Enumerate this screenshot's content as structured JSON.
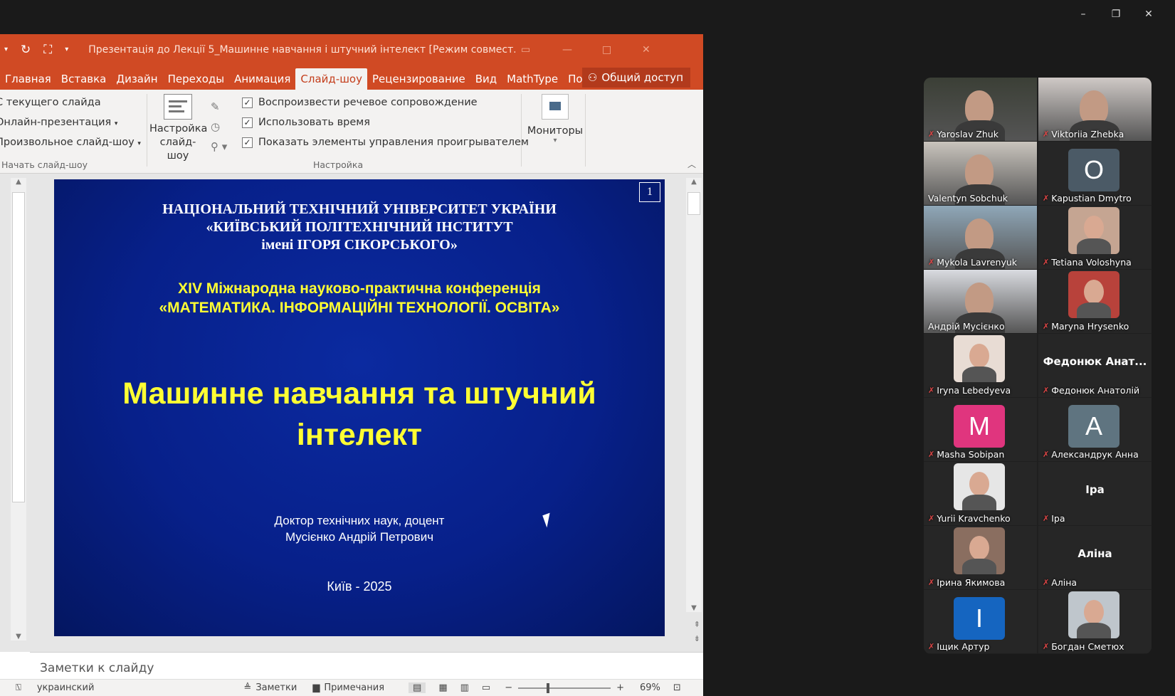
{
  "window": {
    "minimize": "–",
    "restore": "❐",
    "close": "✕"
  },
  "ppt": {
    "title": "Презентація до Лекції 5_Машинне навчання і штучний інтелект [Режим совмест...",
    "tabs": [
      "Главная",
      "Вставка",
      "Дизайн",
      "Переходы",
      "Анимация",
      "Слайд-шоу",
      "Рецензирование",
      "Вид",
      "MathType",
      "Помощ"
    ],
    "active_tab": "Слайд-шоу",
    "share": "Общий доступ",
    "start_group": {
      "items": [
        "С текущего слайда",
        "Онлайн-презентация",
        "Произвольное слайд-шоу"
      ],
      "label": "Начать слайд-шоу"
    },
    "setup_button": "Настройка слайд-шоу",
    "setup_checks": [
      "Воспроизвести речевое сопровождение",
      "Использовать время",
      "Показать элементы управления проигрывателем"
    ],
    "setup_label": "Настройка",
    "monitors": "Мониторы",
    "slide": {
      "number": "1",
      "univ1": "НАЦІОНАЛЬНИЙ ТЕХНІЧНИЙ УНІВЕРСИТЕТ УКРАЇНИ",
      "univ2": "«КИЇВСЬКИЙ ПОЛІТЕХНІЧНИЙ ІНСТИТУТ",
      "univ3": "імені ІГОРЯ СІКОРСЬКОГО»",
      "conf1": "XIV Міжнародна науково-практична конференція",
      "conf2": "«МАТЕМАТИКА. ІНФОРМАЦІЙНІ ТЕХНОЛОГІЇ. ОСВІТА»",
      "title1": "Машинне навчання та штучний",
      "title2": "інтелект",
      "author1": "Доктор технічних наук, доцент",
      "author2": "Мусієнко Андрій Петрович",
      "city": "Київ - 2025"
    },
    "notes_placeholder": "Заметки к слайду",
    "status": {
      "language": "украинский",
      "notes": "Заметки",
      "comments": "Примечания",
      "zoom": "69%"
    }
  },
  "participants": [
    {
      "name": "Yaroslav Zhuk",
      "muted": true,
      "kind": "video",
      "color": "#3b3f36"
    },
    {
      "name": "Viktoriia Zhebka",
      "muted": true,
      "kind": "video",
      "color": "#cfc9c6"
    },
    {
      "name": "Valentyn Sobchuk",
      "muted": false,
      "kind": "video",
      "color": "#c9c4bd"
    },
    {
      "name": "Kapustian Dmytro",
      "muted": true,
      "kind": "letter",
      "letter": "O",
      "color": "#4b5a66"
    },
    {
      "name": "Mykola Lavrenyuk",
      "muted": true,
      "kind": "video",
      "color": "#8fa7b8"
    },
    {
      "name": "Tetiana Voloshyna",
      "muted": true,
      "kind": "photo",
      "color": "#c5a592"
    },
    {
      "name": "Андрій Мусієнко",
      "muted": false,
      "kind": "video",
      "color": "#d9dbe0",
      "active": true
    },
    {
      "name": "Maryna Hrysenko",
      "muted": true,
      "kind": "photo",
      "color": "#b8423b"
    },
    {
      "name": "Iryna Lebedyeva",
      "muted": true,
      "kind": "photo",
      "color": "#e8dcd4"
    },
    {
      "name": "Федонюк Анатолій",
      "muted": true,
      "kind": "text",
      "big": "Федонюк  Анат..."
    },
    {
      "name": "Masha Sobipan",
      "muted": true,
      "kind": "letter",
      "letter": "M",
      "color": "#e0357e"
    },
    {
      "name": "Александрук Анна",
      "muted": true,
      "kind": "letter",
      "letter": "A",
      "color": "#5f7480"
    },
    {
      "name": "Yurii Kravchenko",
      "muted": true,
      "kind": "photo",
      "color": "#e6e6e6"
    },
    {
      "name": "Іра",
      "muted": true,
      "kind": "text",
      "big": "Іра"
    },
    {
      "name": "Ірина Якимова",
      "muted": true,
      "kind": "photo",
      "color": "#8a6e60"
    },
    {
      "name": "Аліна",
      "muted": true,
      "kind": "text",
      "big": "Аліна"
    },
    {
      "name": "Іщик Артур",
      "muted": true,
      "kind": "letter",
      "letter": "I",
      "color": "#1565c0"
    },
    {
      "name": "Богдан Сметюх",
      "muted": true,
      "kind": "photo",
      "color": "#bfc6cc"
    }
  ]
}
